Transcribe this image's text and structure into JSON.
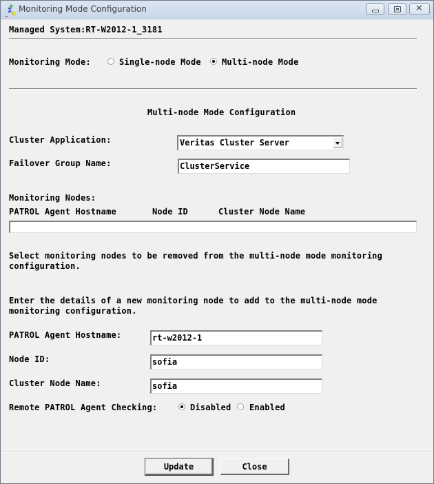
{
  "window": {
    "title": "Monitoring Mode Configuration",
    "icon": "patrol-app-icon",
    "controls": {
      "minimize": "minimize-icon",
      "maximize": "maximize-icon",
      "close": "close-icon"
    }
  },
  "header": {
    "managed_system": "Managed System:RT-W2012-1_3181"
  },
  "monitoring_mode": {
    "label": "Monitoring Mode:",
    "options": [
      {
        "label": "Single-node Mode",
        "selected": false
      },
      {
        "label": "Multi-node Mode",
        "selected": true
      }
    ]
  },
  "multinode": {
    "section_title": "Multi-node Mode Configuration",
    "cluster_application_label": "Cluster Application:",
    "cluster_application_value": "Veritas Cluster Server",
    "failover_group_label": "Failover Group Name:",
    "failover_group_value": "ClusterService",
    "monitoring_nodes_label": "Monitoring Nodes:",
    "columns": [
      "PATROL Agent Hostname",
      "Node ID",
      "Cluster Node Name"
    ],
    "nodes": [],
    "remove_hint_line1": "Select monitoring nodes to be removed from the multi-node mode monitoring",
    "remove_hint_line2": "configuration.",
    "add_hint_line1": "Enter the details of a new monitoring node to add to the multi-node mode",
    "add_hint_line2": "monitoring configuration."
  },
  "new_node": {
    "hostname_label": "PATROL Agent Hostname:",
    "hostname_value": "rt-w2012-1",
    "node_id_label": "Node ID:",
    "node_id_value": "sofia",
    "cluster_node_label": "Cluster Node Name:",
    "cluster_node_value": "sofia",
    "remote_check_label": "Remote PATROL Agent Checking:",
    "remote_check_options": [
      {
        "label": "Disabled",
        "selected": true
      },
      {
        "label": "Enabled",
        "selected": false
      }
    ]
  },
  "buttons": {
    "update": "Update",
    "close": "Close"
  }
}
